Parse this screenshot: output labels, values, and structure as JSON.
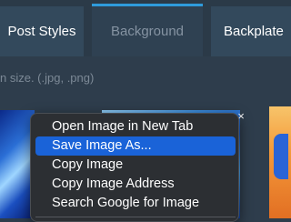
{
  "tabs": [
    {
      "label": "Post Styles",
      "active": false
    },
    {
      "label": "Background",
      "active": true
    },
    {
      "label": "Backplate",
      "active": false
    }
  ],
  "hint_text": "n size. (.jpg, .png)",
  "close_glyph": "×",
  "context_menu": {
    "items": [
      {
        "label": "Open Image in New Tab",
        "highlighted": false
      },
      {
        "label": "Save Image As...",
        "highlighted": true
      },
      {
        "label": "Copy Image",
        "highlighted": false
      },
      {
        "label": "Copy Image Address",
        "highlighted": false
      },
      {
        "label": "Search Google for Image",
        "highlighted": false
      }
    ]
  },
  "colors": {
    "accent": "#2f9bdc",
    "menu_highlight": "#1a63d8",
    "background": "#2e3d4c"
  }
}
